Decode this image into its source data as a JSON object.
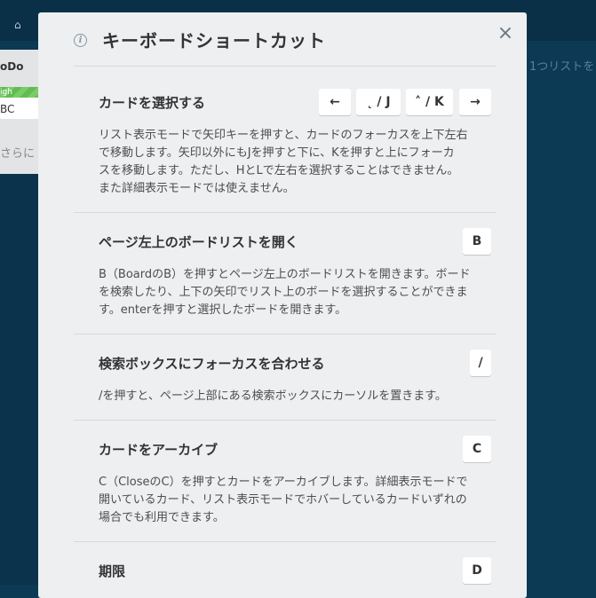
{
  "background": {
    "list_title": "oDo",
    "label_text": "igh",
    "card_text": "BC",
    "more_text": "さらに",
    "right_text": "1つリストを"
  },
  "modal": {
    "title": "キーボードショートカット",
    "close": "×",
    "info_icon": "i",
    "sections": [
      {
        "title": "カードを選択する",
        "keys": [
          "←",
          "˛ / J",
          "˄ / K",
          "→"
        ],
        "desc_lines": [
          "リスト表示モードで矢印キーを押すと、カードのフォーカスを上下左右",
          "で移動します。矢印以外にもJを押すと下に、Kを押すと上にフォーカ",
          "スを移動します。ただし、HとLで左右を選択することはできません。",
          "また詳細表示モードでは使えません。"
        ]
      },
      {
        "title": "ページ左上のボードリストを開く",
        "keys": [
          "B"
        ],
        "desc_lines": [
          "B（BoardのB）を押すとページ左上のボードリストを開きます。ボード",
          "を検索したり、上下の矢印でリスト上のボードを選択することができま",
          "す。enterを押すと選択したボードを開きます。"
        ]
      },
      {
        "title": "検索ボックスにフォーカスを合わせる",
        "keys": [
          "/"
        ],
        "desc_lines": [
          "/を押すと、ページ上部にある検索ボックスにカーソルを置きます。"
        ]
      },
      {
        "title": "カードをアーカイブ",
        "keys": [
          "C"
        ],
        "desc_lines": [
          "C（CloseのC）を押すとカードをアーカイブします。詳細表示モードで",
          "開いているカード、リスト表示モードでホバーしているカードいずれの",
          "場合でも利用できます。"
        ]
      },
      {
        "title": "期限",
        "keys": [
          "D"
        ],
        "desc_lines": []
      }
    ]
  }
}
